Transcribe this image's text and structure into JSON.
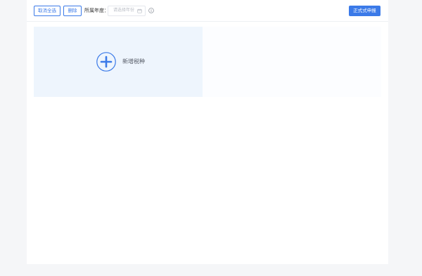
{
  "toolbar": {
    "cancel_select_all_label": "取消全选",
    "delete_label": "删除",
    "year_label": "所属年度：",
    "year_select": {
      "placeholder": "请选择年份",
      "value": ""
    },
    "formal_declare_label": "正式式申报"
  },
  "add_card": {
    "label": "新增税种"
  },
  "icons": {
    "calendar": "calendar-icon",
    "info": "info-icon",
    "plus": "plus-circle-icon"
  },
  "colors": {
    "primary": "#3b7ae8",
    "card_bg": "#eef5fd",
    "page_bg": "#f5f6f8"
  }
}
